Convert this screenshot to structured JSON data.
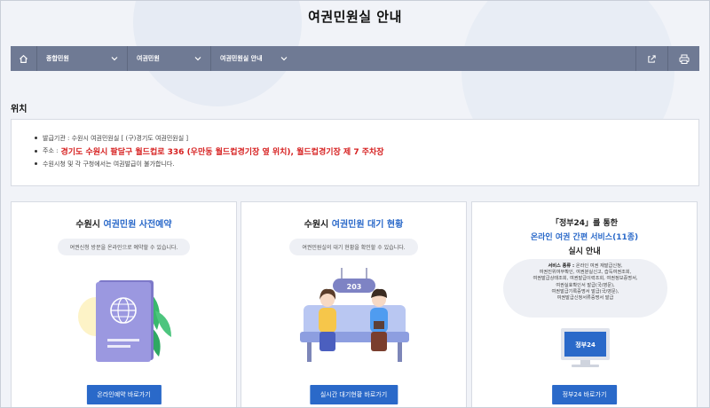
{
  "page": {
    "title": "여권민원실 안내"
  },
  "nav": {
    "items": [
      {
        "label": "종합민원"
      },
      {
        "label": "여권민원"
      },
      {
        "label": "여권민원실 안내"
      }
    ]
  },
  "location": {
    "title": "위치",
    "issuing_agency": "발급기관 : 수원시 여권민원실 [ (구)경기도 여권민원실 ]",
    "address_prefix": "주소 :",
    "address": "경기도 수원시 팔달구 월드컵로 336 (우만동 월드컵경기장 옆 위치), 월드컵경기장 제 7 주차장",
    "notice": "수원시청 및 각 구청에서는 여권발급이 불가합니다."
  },
  "cards": [
    {
      "title_prefix": "수원시 ",
      "title_highlight": "여권민원 사전예약",
      "description": "여권신청 방문을 온라인으로 예약할 수 있습니다.",
      "button": "온라인예약 바로가기"
    },
    {
      "title_prefix": "수원시 ",
      "title_highlight": "여권민원 대기 현황",
      "description": "여권민원실의 대기 현황을 확인할 수 있습니다.",
      "sign_number": "203",
      "button": "실시간 대기현황 바로가기"
    },
    {
      "title_line1": "「정부24」를 통한",
      "title_line2": "온라인 여권 간편 서비스(11종)",
      "title_line3": "실시 안내",
      "services_label": "서비스 종류 : ",
      "services_lines": [
        "온라인 여권 재발급신청,",
        "여권진위여부확인, 여권분실신고, 습득여권조회,",
        "여권발급상태조회, 여권발급이력조회, 여권정보증명서,",
        "여권실효확인서 발급(국/영문),",
        "여권발급기록증명서 발급(국/영문),",
        "여권발급신청서류증명서 발급"
      ],
      "monitor_label": "정부24",
      "button": "정부24 바로가기"
    }
  ],
  "colors": {
    "accent": "#2a69c9",
    "nav_bg": "#6f7a94",
    "address_red": "#d61f1f",
    "page_bg": "#f1f3f8"
  },
  "icons": {
    "home": "home-icon",
    "chevron": "chevron-down-icon",
    "share": "share-icon",
    "print": "print-icon"
  }
}
